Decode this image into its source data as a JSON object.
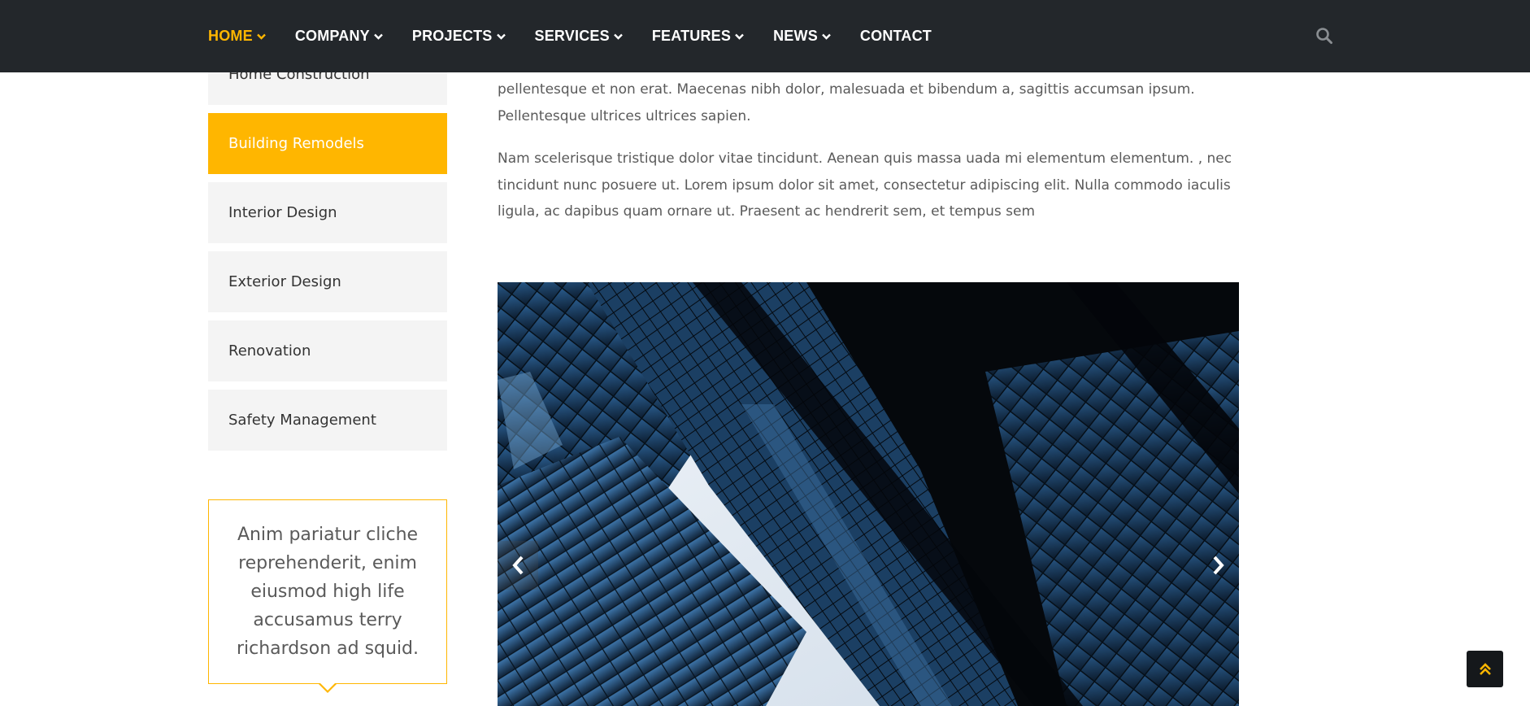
{
  "nav": {
    "items": [
      {
        "label": "HOME",
        "has_dropdown": true,
        "active": true
      },
      {
        "label": "COMPANY",
        "has_dropdown": true,
        "active": false
      },
      {
        "label": "PROJECTS",
        "has_dropdown": true,
        "active": false
      },
      {
        "label": "SERVICES",
        "has_dropdown": true,
        "active": false
      },
      {
        "label": "FEATURES",
        "has_dropdown": true,
        "active": false
      },
      {
        "label": "NEWS",
        "has_dropdown": true,
        "active": false
      },
      {
        "label": "CONTACT",
        "has_dropdown": false,
        "active": false
      }
    ],
    "search_icon": "search-icon"
  },
  "sidebar": {
    "items": [
      {
        "label": "Home Construction",
        "active": false
      },
      {
        "label": "Building Remodels",
        "active": true
      },
      {
        "label": "Interior Design",
        "active": false
      },
      {
        "label": "Exterior Design",
        "active": false
      },
      {
        "label": "Renovation",
        "active": false
      },
      {
        "label": "Safety Management",
        "active": false
      }
    ],
    "quote": "Anim pariatur cliche reprehenderit, enim eiusmod high life accusamus terry richardson ad squid."
  },
  "main": {
    "paragraph_1": "pellentesque et non erat. Maecenas nibh dolor, malesuada et bibendum a, sagittis accumsan ipsum. Pellentesque ultrices ultrices sapien.",
    "paragraph_2": "Nam scelerisque tristique dolor vitae tincidunt. Aenean quis massa uada mi elementum elementum. , nec tincidunt nunc posuere ut. Lorem ipsum dolor sit amet, consectetur adipiscing elit. Nulla commodo iaculis ligula, ac dapibus quam ornare ut. Praesent ac hendrerit sem, et tempus sem"
  },
  "slider": {
    "prev_icon": "chevron-left-icon",
    "next_icon": "chevron-right-icon"
  },
  "back_to_top": {
    "icon": "double-chevron-up-icon"
  },
  "colors": {
    "accent": "#ffb600",
    "nav_bg": "#23272b",
    "menu_bg": "#f4f4f4",
    "text": "#5a5a5a"
  }
}
